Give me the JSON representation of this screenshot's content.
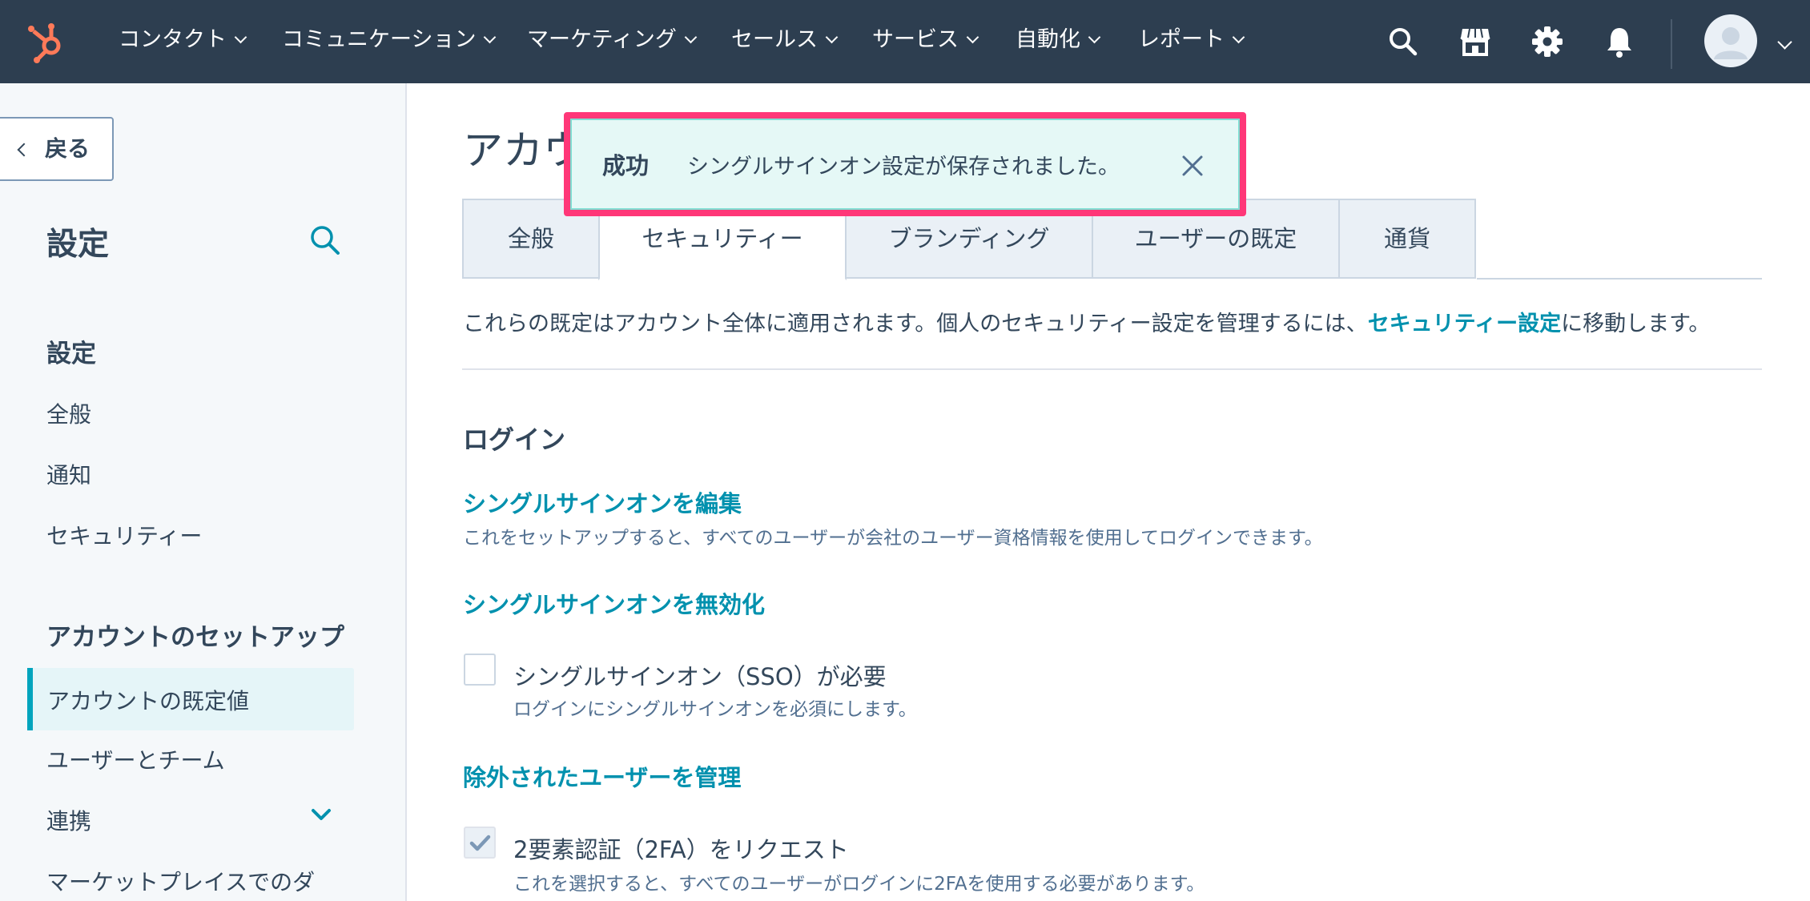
{
  "topnav": {
    "items": [
      {
        "label": "コンタクト"
      },
      {
        "label": "コミュニケーション"
      },
      {
        "label": "マーケティング"
      },
      {
        "label": "セールス"
      },
      {
        "label": "サービス"
      },
      {
        "label": "自動化"
      },
      {
        "label": "レポート"
      }
    ],
    "icons": [
      "search-icon",
      "marketplace-icon",
      "gear-icon",
      "bell-icon"
    ],
    "accent_color": "#ff7a59",
    "background_color": "#2d3e50"
  },
  "sidebar": {
    "back_label": "戻る",
    "title": "設定",
    "section1": {
      "heading": "設定",
      "items": [
        "全般",
        "通知",
        "セキュリティー"
      ]
    },
    "section2": {
      "heading": "アカウントのセットアップ",
      "active_item": "アカウントの既定値",
      "items": [
        "ユーザーとチーム",
        "連携",
        "マーケットプレイスでのダ"
      ]
    }
  },
  "main": {
    "page_title": "アカウ",
    "tabs": [
      {
        "label": "全般",
        "active": false
      },
      {
        "label": "セキュリティー",
        "active": true
      },
      {
        "label": "ブランディング",
        "active": false
      },
      {
        "label": "ユーザーの既定",
        "active": false
      },
      {
        "label": "通貨",
        "active": false
      }
    ],
    "intro_before": "これらの既定はアカウント全体に適用されます。個人のセキュリティー設定を管理するには、",
    "intro_link": "セキュリティー設定",
    "intro_after": "に移動します。",
    "login": {
      "title": "ログイン",
      "edit_sso_link": "シングルサインオンを編集",
      "edit_sso_desc": "これをセットアップすると、すべてのユーザーが会社のユーザー資格情報を使用してログインできます。",
      "disable_sso_link": "シングルサインオンを無効化",
      "sso_required_label": "シングルサインオン（SSO）が必要",
      "sso_required_desc": "ログインにシングルサインオンを必須にします。",
      "sso_required_checked": false,
      "manage_excluded_link": "除外されたユーザーを管理",
      "twofa_label": "2要素認証（2FA）をリクエスト",
      "twofa_desc": "これを選択すると、すべてのユーザーがログインに2FAを使用する必要があります。",
      "twofa_checked": true
    },
    "link_color": "#0091ae"
  },
  "toast": {
    "title": "成功",
    "message": "シングルサインオン設定が保存されました。",
    "highlight_color": "#ff3778"
  }
}
